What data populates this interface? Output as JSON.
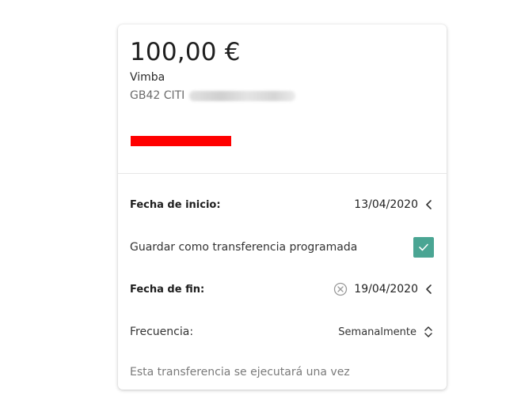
{
  "transfer": {
    "amount": "100,00 €",
    "payee": "Vimba",
    "iban_prefix": "GB42 CITI"
  },
  "schedule": {
    "start_label": "Fecha de inicio:",
    "start_date": "13/04/2020",
    "save_label": "Guardar como transferencia programada",
    "save_checked": true,
    "end_label": "Fecha de fin:",
    "end_date": "19/04/2020",
    "frequency_label": "Frecuencia:",
    "frequency_value": "Semanalmente",
    "info": "Esta transferencia se ejecutará una vez"
  },
  "colors": {
    "checkbox": "#4aa593",
    "redaction": "#ff0000"
  },
  "icons": {
    "start_date_chevron": "chevron-left-icon",
    "end_date_clear": "clear-circle-icon",
    "end_date_chevron": "chevron-left-icon",
    "frequency_selector": "up-down-chevron-icon",
    "checkbox_mark": "checkmark-icon"
  }
}
